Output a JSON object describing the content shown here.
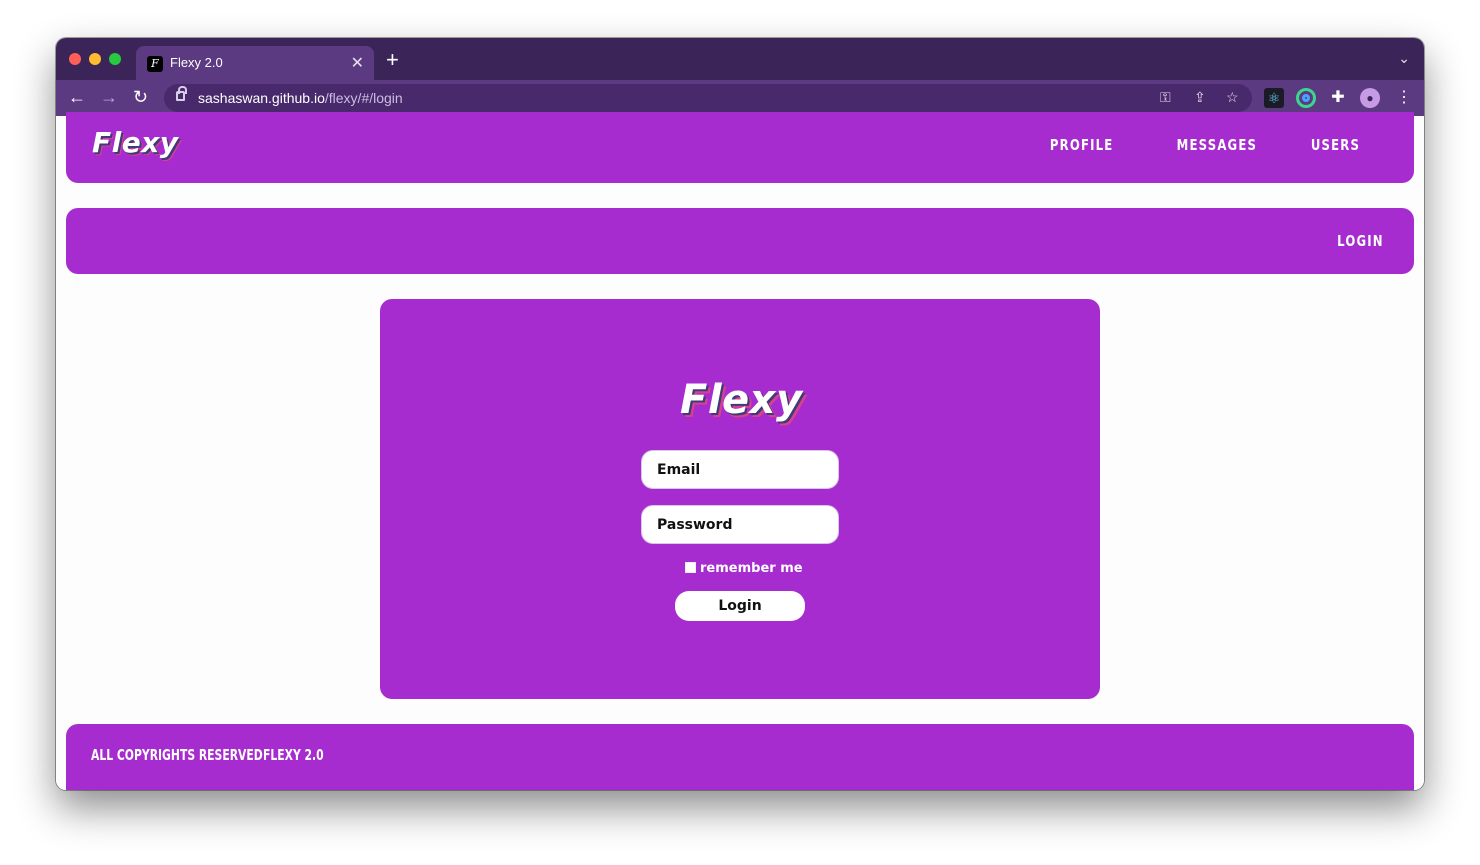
{
  "browser": {
    "tab_title": "Flexy 2.0",
    "favicon_letter": "F",
    "new_tab": "+",
    "url_host": "sashaswan.github.io",
    "url_path": "/flexy/#/login"
  },
  "header": {
    "brand": "Flexy",
    "nav": [
      "PROFILE",
      "MESSAGES",
      "USERS"
    ]
  },
  "subbar": {
    "login_link": "LOGIN"
  },
  "login_card": {
    "brand": "Flexy",
    "email_placeholder": "Email",
    "password_placeholder": "Password",
    "remember_label": "remember me",
    "remember_checked": false,
    "login_button": "Login"
  },
  "footer": {
    "copyright": "ALL COPYRIGHTS RESERVED",
    "version": "FLEXY 2.0"
  },
  "colors": {
    "accent": "#a62ccf",
    "browser_frame": "#3b2558",
    "browser_toolbar": "#5b3a82"
  }
}
